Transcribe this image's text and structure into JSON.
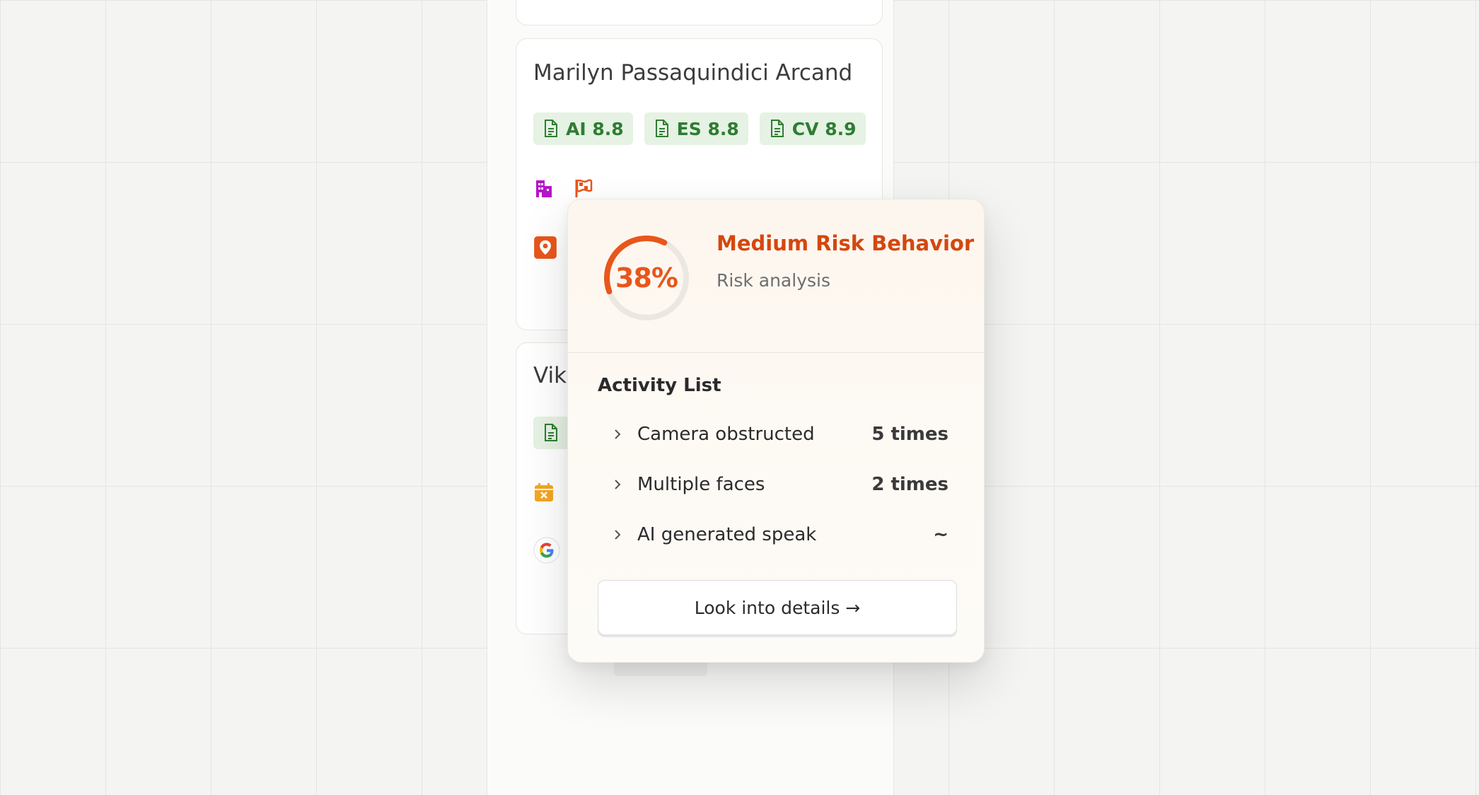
{
  "candidates": [
    {
      "name": "Marilyn Passaquindici Arcand",
      "scores": [
        {
          "label": "AI",
          "value": "8.8"
        },
        {
          "label": "ES",
          "value": "8.8"
        },
        {
          "label": "CV",
          "value": "8.9"
        }
      ],
      "icons": [
        "building-icon",
        "flag-icon"
      ],
      "source_icon": "location-pin-icon"
    },
    {
      "name_visible": "Vik",
      "icons": [
        "calendar-x-icon"
      ],
      "source_icon": "google-icon"
    }
  ],
  "risk_popup": {
    "percent": "38%",
    "percent_value": 38,
    "title": "Medium Risk Behavior",
    "subtitle": "Risk analysis",
    "activity_title": "Activity List",
    "activities": [
      {
        "label": "Camera obstructed",
        "count": "5 times"
      },
      {
        "label": "Multiple faces",
        "count": "2 times"
      },
      {
        "label": "AI generated speak",
        "count": "~"
      }
    ],
    "button_label": "Look into details →"
  },
  "colors": {
    "accent_orange": "#e8561b",
    "risk_title": "#d4470e",
    "chip_green_bg": "#e6f2e4",
    "chip_green_text": "#2e7d32"
  }
}
